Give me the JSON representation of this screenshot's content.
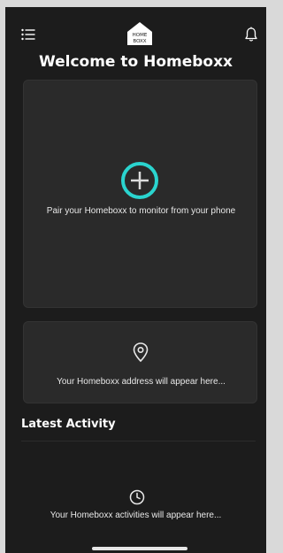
{
  "header": {
    "title": "Welcome to Homeboxx",
    "logo_text_line1": "HOME",
    "logo_text_line2": "BOXX"
  },
  "pair_card": {
    "message": "Pair your Homeboxx to monitor from your phone"
  },
  "address_card": {
    "message": "Your Homeboxx address will appear here..."
  },
  "activity": {
    "title": "Latest Activity",
    "empty_message": "Your Homeboxx activities will appear here..."
  },
  "icons": {
    "menu": "menu-icon",
    "bell": "bell-icon",
    "add": "plus-icon",
    "location": "map-pin-icon",
    "clock": "clock-icon"
  },
  "colors": {
    "background": "#1c1c1c",
    "card": "#2a2a2a",
    "accent": "#2ad4cf",
    "text": "#ffffff"
  }
}
